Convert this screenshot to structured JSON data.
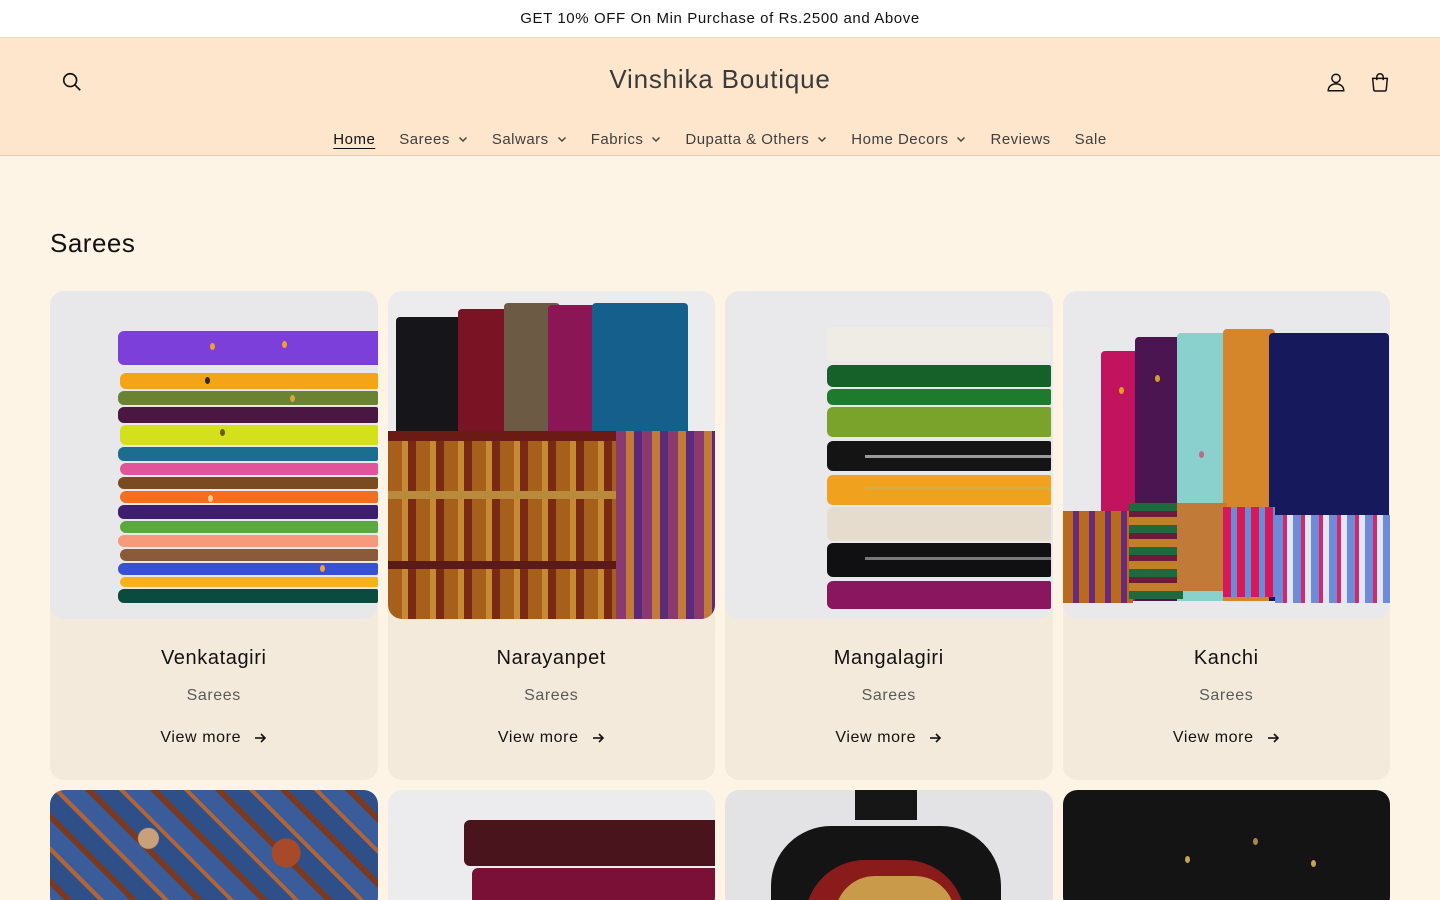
{
  "announcement": "GET 10% OFF On Min Purchase of Rs.2500 and Above",
  "header": {
    "logo": "Vinshika Boutique",
    "icons": {
      "search": "search-icon",
      "account": "account-icon",
      "cart": "cart-icon"
    }
  },
  "nav": [
    {
      "label": "Home",
      "active": true,
      "dropdown": false
    },
    {
      "label": "Sarees",
      "dropdown": true
    },
    {
      "label": "Salwars",
      "dropdown": true
    },
    {
      "label": "Fabrics",
      "dropdown": true
    },
    {
      "label": "Dupatta & Others",
      "dropdown": true
    },
    {
      "label": "Home Decors",
      "dropdown": true
    },
    {
      "label": "Reviews",
      "dropdown": false
    },
    {
      "label": "Sale",
      "dropdown": false
    }
  ],
  "section": {
    "title": "Sarees",
    "cards": [
      {
        "title": "Venkatagiri",
        "category": "Sarees",
        "link": "View more"
      },
      {
        "title": "Narayanpet",
        "category": "Sarees",
        "link": "View more"
      },
      {
        "title": "Mangalagiri",
        "category": "Sarees",
        "link": "View more"
      },
      {
        "title": "Kanchi",
        "category": "Sarees",
        "link": "View more"
      }
    ]
  },
  "colors": {
    "announcement_bg": "#ffffff",
    "header_bg": "#fee6cd",
    "page_bg": "#fdf4e5",
    "card_bg": "#f4eadc"
  }
}
